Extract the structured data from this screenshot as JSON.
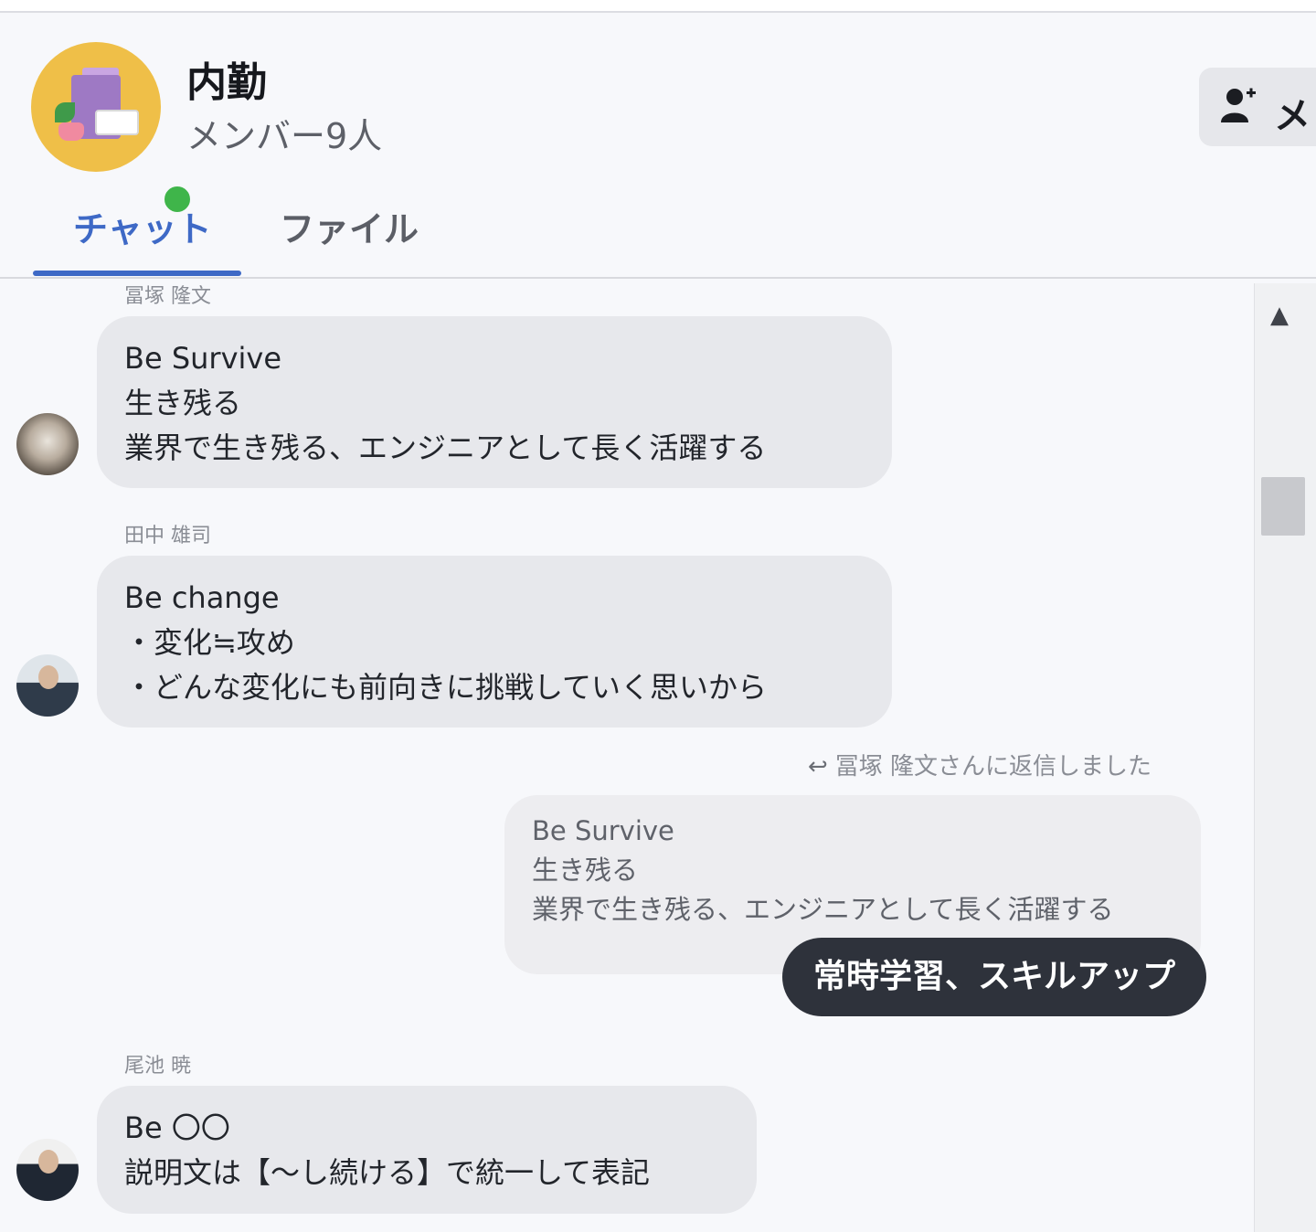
{
  "header": {
    "group_name": "内勤",
    "member_count": "メンバー9人",
    "member_button_label": "メ",
    "member_button_icon": "add-user-icon"
  },
  "tabs": [
    {
      "label": "チャット",
      "active": true
    },
    {
      "label": "ファイル",
      "active": false
    }
  ],
  "colors": {
    "accent": "#3e69c6",
    "online": "#3fb54a",
    "own_bubble": "#2e323b"
  },
  "messages": [
    {
      "sender": "冨塚 隆文",
      "lines": [
        "Be Survive",
        "生き残る",
        "業界で生き残る、エンジニアとして長く活躍する"
      ]
    },
    {
      "sender": "田中 雄司",
      "lines": [
        "Be change",
        "・変化≒攻め",
        "・どんな変化にも前向きに挑戦していく思いから"
      ]
    },
    {
      "reply_note": "冨塚 隆文さんに返信しました",
      "quoted_lines": [
        "Be Survive",
        "生き残る",
        "業界で生き残る、エンジニアとして長く活躍する"
      ],
      "text": "常時学習、スキルアップ"
    },
    {
      "sender": "尾池 暁",
      "lines": [
        "Be 〇〇",
        "説明文は【～し続ける】で統一して表記"
      ]
    }
  ]
}
